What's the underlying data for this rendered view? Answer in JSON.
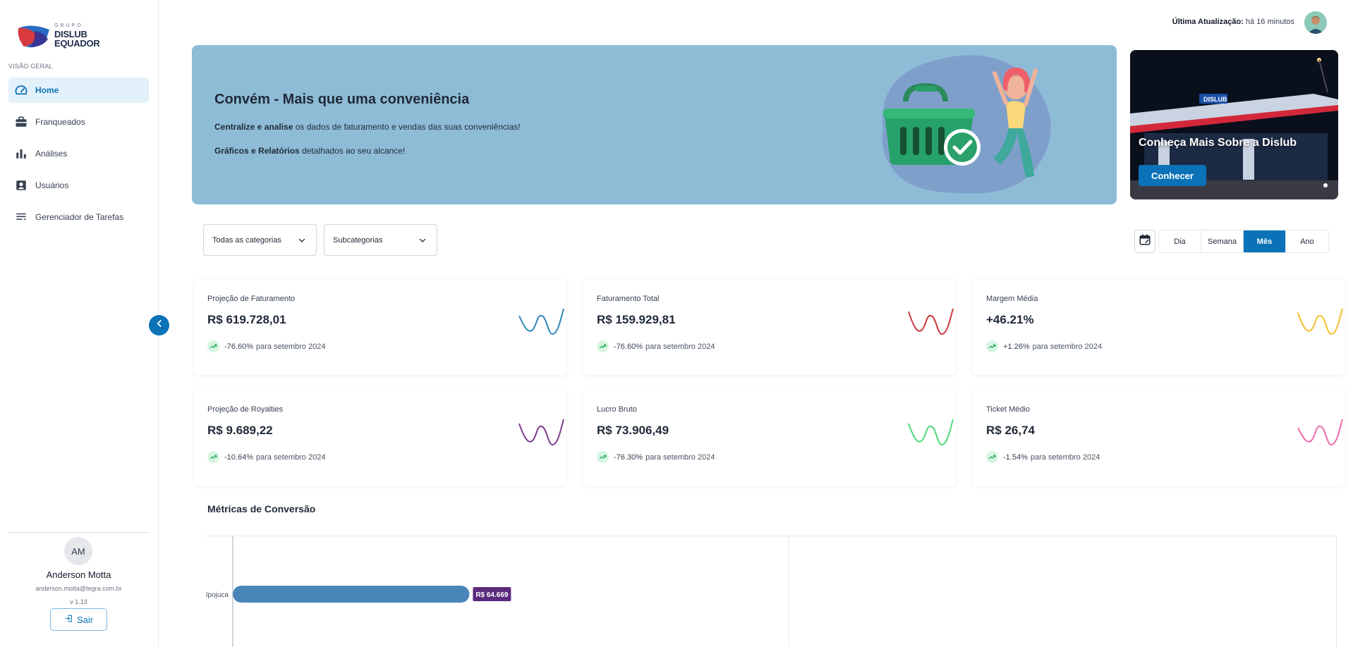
{
  "sidebar": {
    "logo": {
      "grupo": "GRUPO",
      "line1": "DISLUB",
      "line2": "EQUADOR"
    },
    "section_label": "VISÃO GERAL",
    "items": [
      {
        "label": "Home",
        "icon": "dashboard-icon",
        "active": true
      },
      {
        "label": "Franqueados",
        "icon": "briefcase-icon",
        "active": false
      },
      {
        "label": "Análises",
        "icon": "bar-chart-icon",
        "active": false
      },
      {
        "label": "Usuários",
        "icon": "user-badge-icon",
        "active": false
      },
      {
        "label": "Gerenciador de Tarefas",
        "icon": "list-icon",
        "active": false
      }
    ],
    "user": {
      "initials": "AM",
      "name": "Anderson Motta",
      "email": "anderson.motta@tegra.com.br",
      "version": "v 1.13"
    },
    "logout_label": "Sair"
  },
  "header": {
    "last_update_label": "Última Atualização:",
    "last_update_value": "há 16 minutos"
  },
  "banner": {
    "title": "Convém - Mais que uma conveniência",
    "line1_bold": "Centralize e analise",
    "line1_rest": "os dados de faturamento e vendas das suas conveniências!",
    "line2_bold": "Gráficos e Relatórios",
    "line2_rest": "detalhados ao seu alcance!"
  },
  "promo": {
    "title": "Conheça Mais Sobre a Dislub",
    "button_label": "Conhecer",
    "sign_text": "DISLUB"
  },
  "filters": {
    "category": "Todas as categorias",
    "subcategory": "Subcategorias",
    "periods": [
      "Dia",
      "Semana",
      "Mês",
      "Ano"
    ],
    "active_period": "Mês"
  },
  "kpis": [
    {
      "label": "Projeção de Faturamento",
      "value": "R$ 619.728,01",
      "pct": "-76.60%",
      "suffix": "para setembro 2024",
      "color": "#2f86b8"
    },
    {
      "label": "Faturamento Total",
      "value": "R$ 159.929,81",
      "pct": "-76.60%",
      "suffix": "para setembro 2024",
      "color": "#c8383e"
    },
    {
      "label": "Margem Média",
      "value": "+46.21%",
      "pct": "+1.26%",
      "suffix": "para setembro 2024",
      "color": "#f2c02c"
    },
    {
      "label": "Projeção de Royalties",
      "value": "R$ 9.689,22",
      "pct": "-10.64%",
      "suffix": "para setembro 2024",
      "color": "#7b3d8f"
    },
    {
      "label": "Lucro Bruto",
      "value": "R$ 73.906,49",
      "pct": "-76.30%",
      "suffix": "para setembro 2024",
      "color": "#4fd97a"
    },
    {
      "label": "Ticket Médio",
      "value": "R$ 26,74",
      "pct": "-1.54%",
      "suffix": "para setembro 2024",
      "color": "#ef6aa8"
    }
  ],
  "metrics": {
    "title": "Métricas de Conversão"
  },
  "chart_data": {
    "type": "bar",
    "orientation": "horizontal",
    "categories": [
      "Ipojuca"
    ],
    "values": [
      64669
    ],
    "value_labels": [
      "R$ 64.669"
    ],
    "bar_color": "#4a85b9",
    "label_color": "#5b2a7e"
  }
}
